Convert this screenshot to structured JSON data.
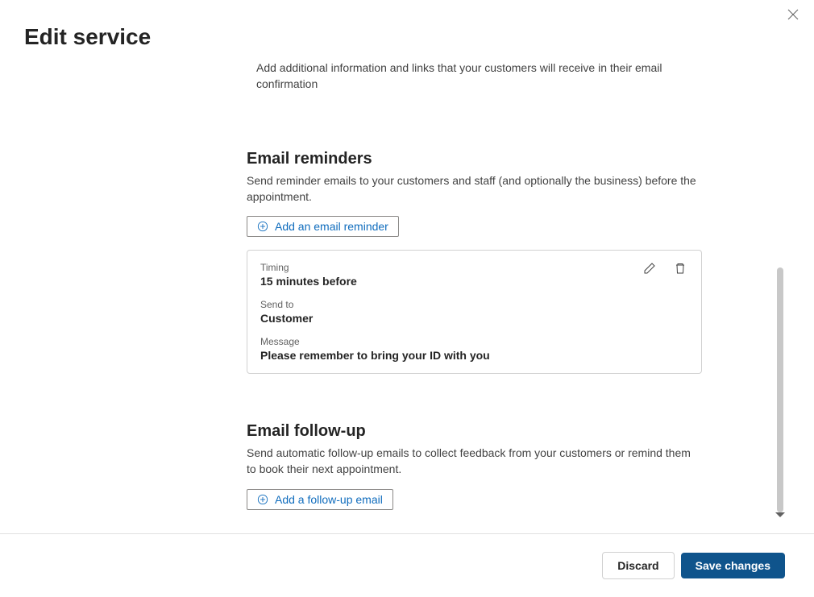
{
  "header": {
    "title": "Edit service"
  },
  "confirmation": {
    "help_text": "Add additional information and links that your customers will receive in their email confirmation"
  },
  "reminders": {
    "title": "Email reminders",
    "description": "Send reminder emails to your customers and staff (and optionally the business) before the appointment.",
    "add_button_label": "Add an email reminder",
    "card": {
      "timing_label": "Timing",
      "timing_value": "15 minutes before",
      "sendto_label": "Send to",
      "sendto_value": "Customer",
      "message_label": "Message",
      "message_value": "Please remember to bring your ID with you"
    }
  },
  "followup": {
    "title": "Email follow-up",
    "description": "Send automatic follow-up emails to collect feedback from your customers or remind them to book their next appointment.",
    "add_button_label": "Add a follow-up email"
  },
  "footer": {
    "discard_label": "Discard",
    "save_label": "Save changes"
  }
}
